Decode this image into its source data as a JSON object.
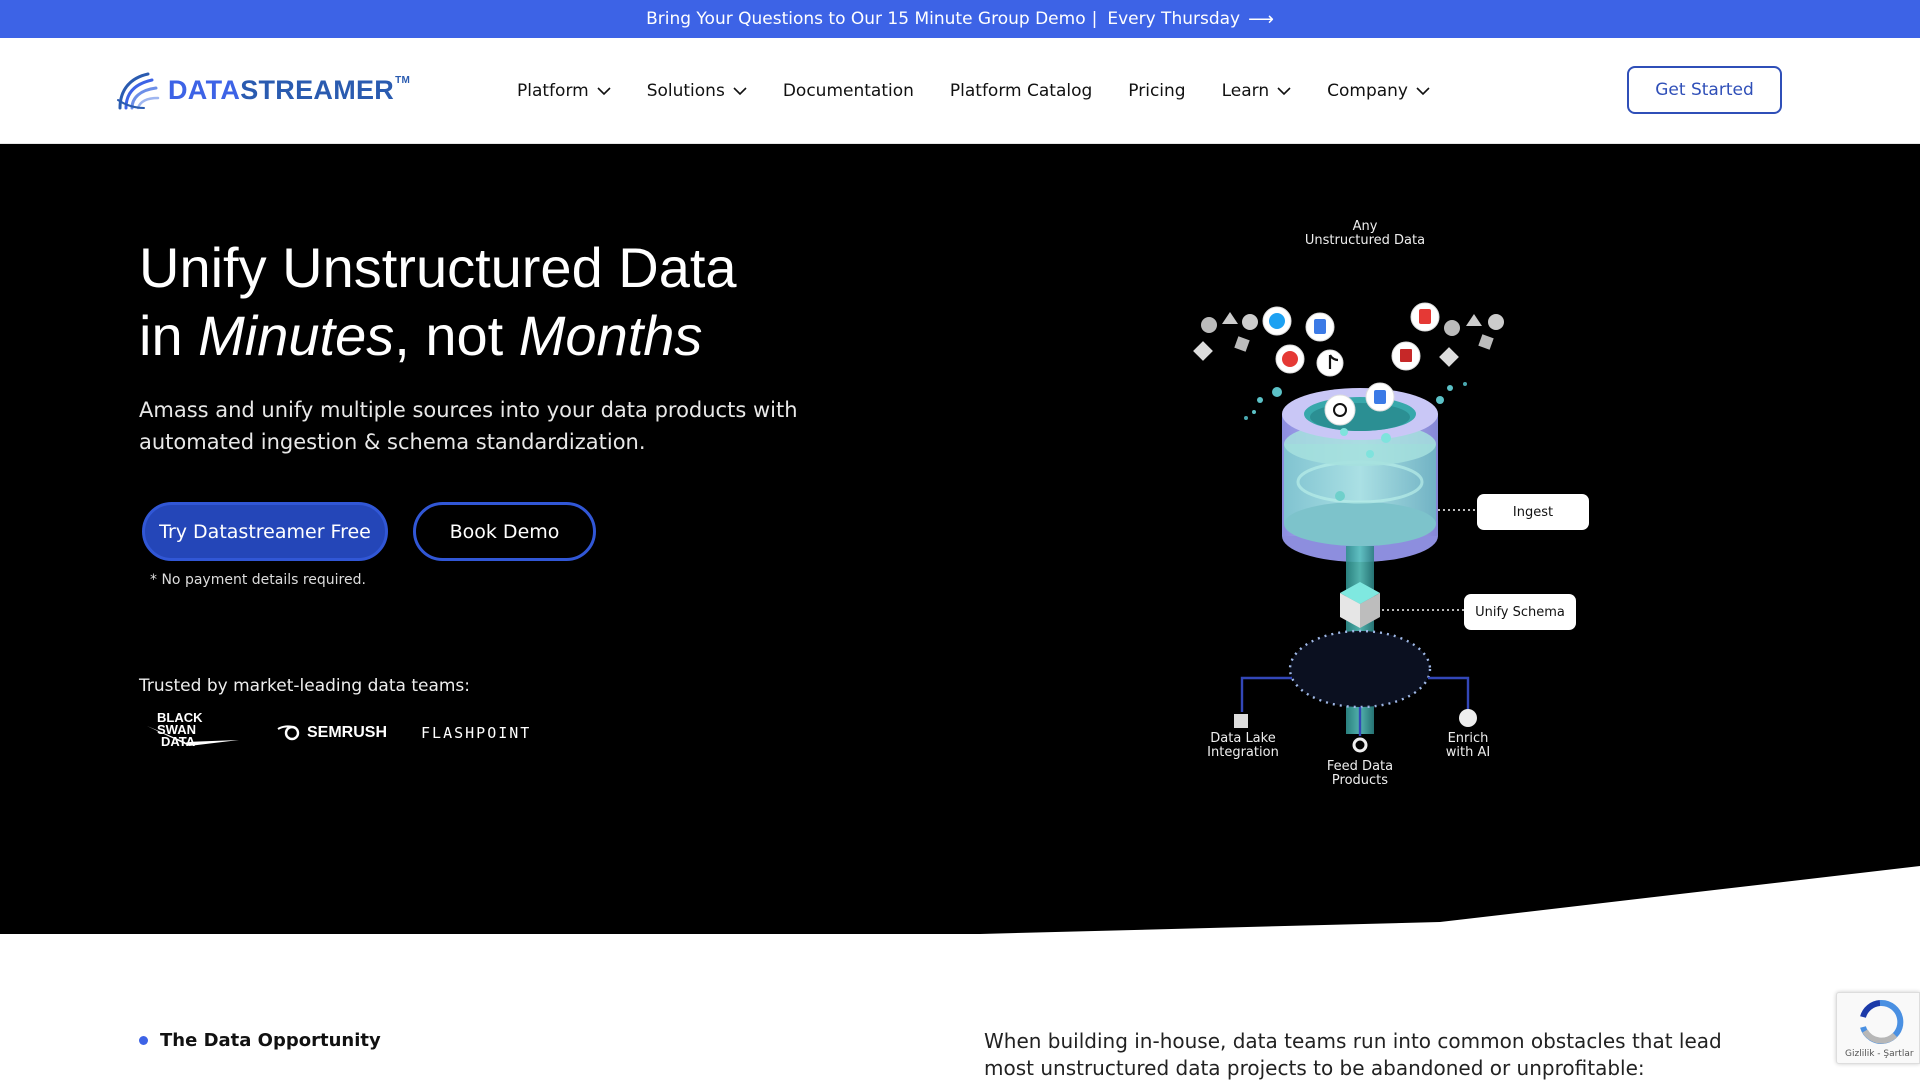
{
  "announcement": {
    "text": "Bring Your Questions to Our 15 Minute Group Demo",
    "separator": "|",
    "suffix": "Every Thursday",
    "arrow": "⟶"
  },
  "brand": {
    "part_a": "DATA",
    "part_b": "STREAMER",
    "tm": "TM"
  },
  "nav": {
    "items": [
      {
        "label": "Platform",
        "dropdown": true
      },
      {
        "label": "Solutions",
        "dropdown": true
      },
      {
        "label": "Documentation",
        "dropdown": false
      },
      {
        "label": "Platform Catalog",
        "dropdown": false
      },
      {
        "label": "Pricing",
        "dropdown": false
      },
      {
        "label": "Learn",
        "dropdown": true
      },
      {
        "label": "Company",
        "dropdown": true
      }
    ],
    "cta": "Get Started"
  },
  "hero": {
    "title_line1": "Unify Unstructured Data",
    "title_in": "in ",
    "title_minutes": "Minutes",
    "title_not": ", not ",
    "title_months": "Months",
    "subtitle": "Amass and unify multiple sources into your data products with automated ingestion & schema standardization.",
    "primary_button": "Try Datastreamer Free",
    "secondary_button": "Book Demo",
    "note": "* No payment details required.",
    "trusted_label": "Trusted by market-leading data teams:",
    "logos": {
      "bsd_line1": "BLACK",
      "bsd_line2": "SWAN",
      "bsd_line3": "DATA",
      "semrush": "SEMRUSH",
      "flashpoint": "FLASHPOINT"
    }
  },
  "diagram": {
    "top_label_1": "Any",
    "top_label_2": "Unstructured Data",
    "ingest": "Ingest",
    "unify": "Unify Schema",
    "out_lake_1": "Data Lake",
    "out_lake_2": "Integration",
    "out_feed_1": "Feed Data",
    "out_feed_2": "Products",
    "out_enrich_1": "Enrich",
    "out_enrich_2": "with AI"
  },
  "section": {
    "label": "The Data Opportunity",
    "text": "When building in-house, data teams run into common obstacles that lead most unstructured data projects to be abandoned or unprofitable:"
  },
  "recaptcha": {
    "text": "Gizlilik - Şartlar"
  },
  "colors": {
    "accent": "#3d63e6",
    "primary_button": "#2446b8",
    "hero_bg": "#000000"
  }
}
